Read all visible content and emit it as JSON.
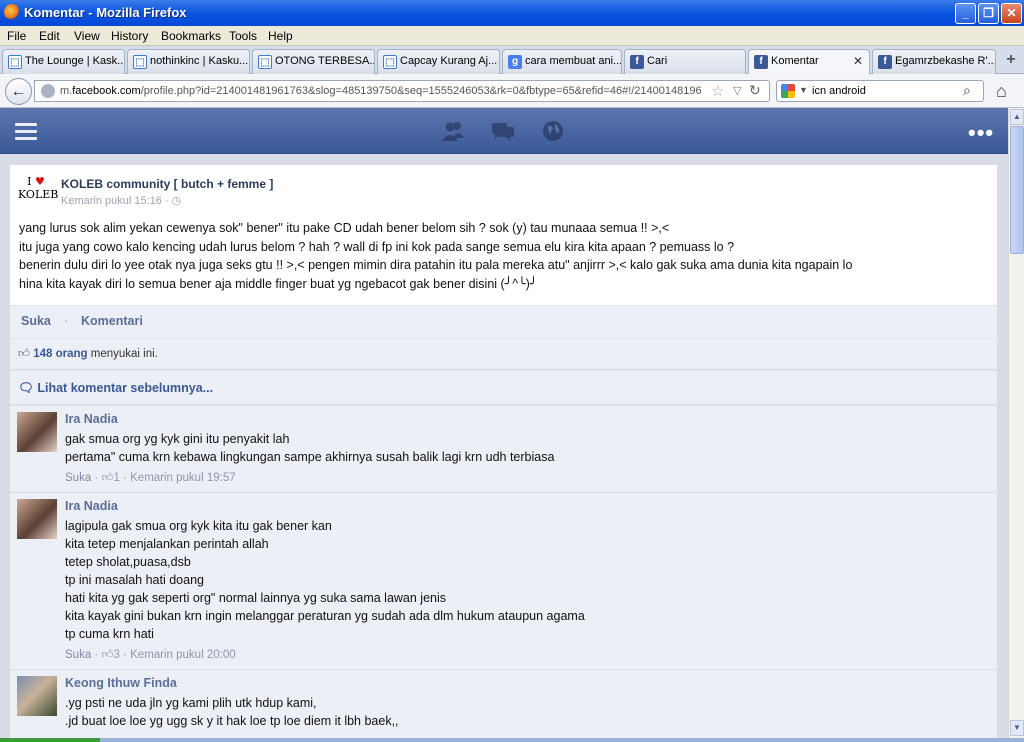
{
  "window": {
    "title": "Komentar - Mozilla Firefox",
    "controls": {
      "minimize": "_",
      "maximize": "❐",
      "close": "✕"
    }
  },
  "menubar": [
    "File",
    "Edit",
    "View",
    "History",
    "Bookmarks",
    "Tools",
    "Help"
  ],
  "tabs": [
    {
      "label": "The Lounge | Kask...",
      "icon": "kaskus-icon",
      "glyph": "⬚"
    },
    {
      "label": "nothinkinc | Kasku...",
      "icon": "kaskus-icon",
      "glyph": "⬚"
    },
    {
      "label": "OTONG TERBESA...",
      "icon": "kaskus-icon",
      "glyph": "⬚"
    },
    {
      "label": "Capcay Kurang Aj...",
      "icon": "kaskus-icon",
      "glyph": "⬚"
    },
    {
      "label": "cara membuat ani...",
      "icon": "google-icon",
      "glyph": "g"
    },
    {
      "label": "Cari",
      "icon": "facebook-icon",
      "glyph": "f"
    },
    {
      "label": "Komentar",
      "icon": "facebook-icon",
      "glyph": "f",
      "active": true
    },
    {
      "label": "Egamrzbekashe R'...",
      "icon": "facebook-icon",
      "glyph": "f"
    }
  ],
  "navbar": {
    "url_prefix": "m.",
    "url_domain": "facebook.com",
    "url_rest": "/profile.php?id=214001481961763&slog=485139750&seq=1555246053&rk=0&fbtype=65&refid=46#!/21400148196",
    "search_query": "icn android"
  },
  "colors": {
    "facebook_blue": "#3b5998",
    "link_gray_blue": "#5b6d99",
    "titlebar_blue": "#0a55e0"
  },
  "post": {
    "logo_top": "I",
    "logo_heart": "♥",
    "logo_bottom": "KOLEB",
    "page_name": "KOLEB community [ butch + femme ]",
    "time": "Kemarin pukul 15:16 · ◷",
    "message": "yang lurus sok alim yekan cewenya sok\" bener\" itu pake CD udah bener belom sih ? sok (y) tau munaaa semua !! >,<\nitu juga yang cowo kalo kencing udah lurus belom ? hah ? wall di fp ini kok pada sange semua elu kira kita apaan ? pemuass lo ?\nbenerin dulu diri lo yee otak nya juga seks gtu !! >,< pengen mimin dira patahin itu pala mereka atu\" anjirrr >,< kalo gak suka ama dunia kita ngapain lo\nhina kita kayak diri lo semua bener aja middle finger buat yg ngebacot gak bener disini (╯^╰)╯"
  },
  "actions": {
    "like": "Suka",
    "dot": "·",
    "comment": "Komentari"
  },
  "likes": {
    "count": "148 orang",
    "suffix": " menyukai ini."
  },
  "prev_comments": "Lihat komentar sebelumnya...",
  "comments": [
    {
      "author": "Ira Nadia",
      "text": "gak smua org yg kyk gini itu penyakit lah\npertama\" cuma krn kebawa lingkungan sampe akhirnya susah balik lagi krn udh terbiasa",
      "like_label": "Suka",
      "like_count": "1",
      "time": "Kemarin pukul 19:57"
    },
    {
      "author": "Ira Nadia",
      "text": "lagipula gak smua org kyk kita itu gak bener kan\nkita tetep menjalankan perintah allah\ntetep sholat,puasa,dsb\ntp ini masalah hati doang\nhati kita yg gak seperti org\" normal lainnya yg suka sama lawan jenis\nkita kayak gini bukan krn ingin melanggar peraturan yg sudah ada dlm hukum ataupun agama\ntp cuma krn hati",
      "like_label": "Suka",
      "like_count": "3",
      "time": "Kemarin pukul 20:00"
    },
    {
      "author": "Keong Ithuw Finda",
      "text": ".yg psti ne uda jln yg kami plih utk hdup kami,\n.jd buat loe loe yg ugg sk y it hak loe tp loe diem it lbh baek,,"
    }
  ]
}
